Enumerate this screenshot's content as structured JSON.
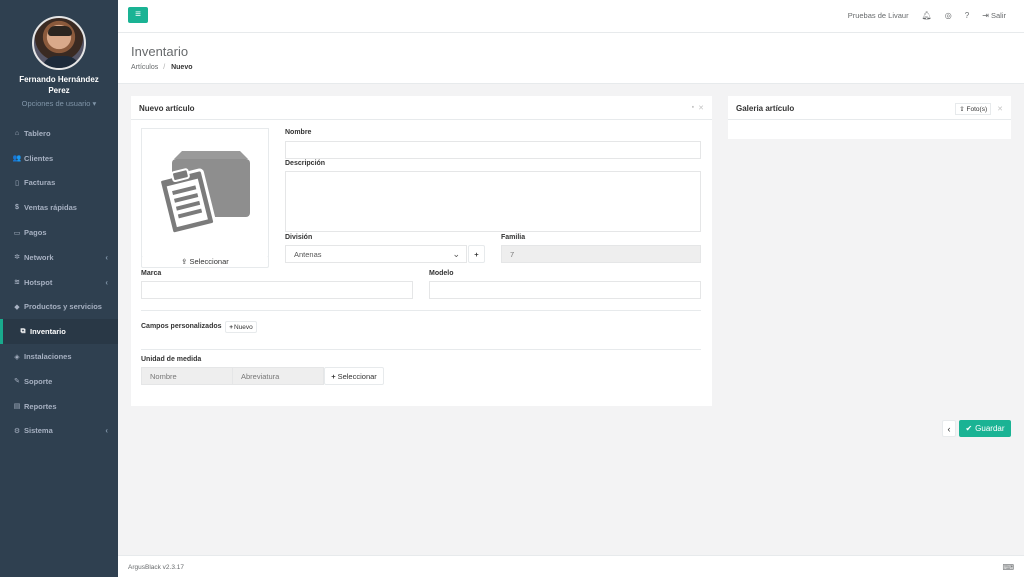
{
  "user": {
    "name": "Fernando Hernández Perez",
    "options": "Opciones de usuario ▾"
  },
  "nav": [
    {
      "icon": "dashboard-icon",
      "glyph": "⌂",
      "label": "Tablero",
      "arrow": ""
    },
    {
      "icon": "users-icon",
      "glyph": "👥",
      "label": "Clientes",
      "arrow": ""
    },
    {
      "icon": "file-icon",
      "glyph": "▯",
      "label": "Facturas",
      "arrow": ""
    },
    {
      "icon": "dollar-icon",
      "glyph": "$",
      "label": "Ventas rápidas",
      "arrow": ""
    },
    {
      "icon": "money-icon",
      "glyph": "▭",
      "label": "Pagos",
      "arrow": ""
    },
    {
      "icon": "network-icon",
      "glyph": "✲",
      "label": "Network",
      "arrow": "‹"
    },
    {
      "icon": "wifi-icon",
      "glyph": "≋",
      "label": "Hotspot",
      "arrow": "‹"
    },
    {
      "icon": "tag-icon",
      "glyph": "◆",
      "label": "Productos y servicios",
      "arrow": ""
    },
    {
      "icon": "cubes-icon",
      "glyph": "⧉",
      "label": "Inventario",
      "arrow": ""
    },
    {
      "icon": "wrench-icon",
      "glyph": "◈",
      "label": "Instalaciones",
      "arrow": ""
    },
    {
      "icon": "tools-icon",
      "glyph": "✎",
      "label": "Soporte",
      "arrow": ""
    },
    {
      "icon": "book-icon",
      "glyph": "▤",
      "label": "Reportes",
      "arrow": ""
    },
    {
      "icon": "cogs-icon",
      "glyph": "⚙",
      "label": "Sistema",
      "arrow": "‹"
    }
  ],
  "topbar": {
    "account": "Pruebas de Livaur",
    "logout": "Salir"
  },
  "heading": {
    "title": "Inventario",
    "crumb_parent": "Artículos",
    "crumb_sep": "/",
    "crumb_current": "Nuevo"
  },
  "article_panel": {
    "title": "Nuevo artículo",
    "select_image": "Seleccionar",
    "name_label": "Nombre",
    "name_value": "",
    "description_label": "Descripción",
    "description_value": "",
    "division_label": "División",
    "division_value": "Antenas",
    "family_label": "Familia",
    "family_value": "7",
    "brand_label": "Marca",
    "brand_value": "",
    "model_label": "Modelo",
    "model_value": "",
    "custom_fields_label": "Campos personalizados",
    "custom_new": "Nuevo",
    "unit_label": "Unidad de medida",
    "unit_name_placeholder": "Nombre",
    "unit_abbr_placeholder": "Abreviatura",
    "unit_select": "Seleccionar"
  },
  "gallery_panel": {
    "title": "Galeria artículo",
    "photos_button": "Foto(s)"
  },
  "actions": {
    "back": "‹",
    "save": "Guardar"
  },
  "footer": {
    "version": "ArgusBlack v2.3.17"
  },
  "colors": {
    "primary": "#1ab394",
    "sidebar": "#2f4050"
  }
}
